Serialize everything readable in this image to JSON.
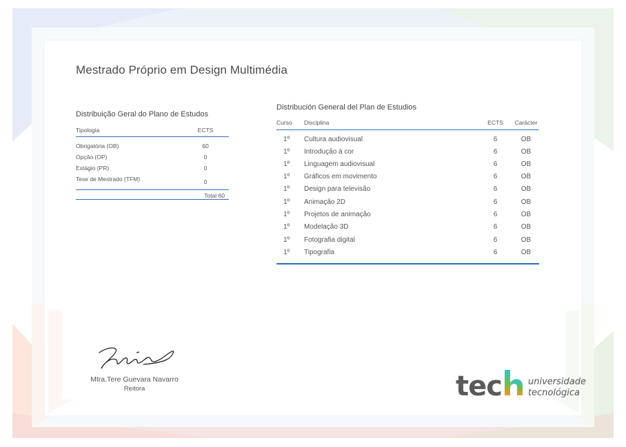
{
  "colors": {
    "accent": "#2c6fb5",
    "logo_text": "#5a5a5a",
    "logo_h_top": "#2ec4d6",
    "logo_h_bottom": "#f7931e"
  },
  "title": "Mestrado Próprio em Design Multimédia",
  "left_table": {
    "heading": "Distribuição Geral do Plano de Estudos",
    "col_type": "Tipologia",
    "col_ects": "ECTS",
    "rows": [
      {
        "type": "Obrigatória (OB)",
        "ects": "60"
      },
      {
        "type": "Opção (OP)",
        "ects": "0"
      },
      {
        "type": "Estágio (PR)",
        "ects": "0"
      },
      {
        "type": "Tese de Mestrado (TFM)",
        "ects": "0"
      }
    ],
    "total": "Total 60"
  },
  "right_table": {
    "heading": "Distribución General del Plan de Estudios",
    "col_course": "Curso",
    "col_subject": "Disciplina",
    "col_ects": "ECTS",
    "col_character": "Carácter",
    "rows": [
      {
        "course": "1º",
        "subject": "Cultura audiovisual",
        "ects": "6",
        "character": "OB"
      },
      {
        "course": "1º",
        "subject": "Introdução à cor",
        "ects": "6",
        "character": "OB"
      },
      {
        "course": "1º",
        "subject": "Linguagem audiovisual",
        "ects": "6",
        "character": "OB"
      },
      {
        "course": "1º",
        "subject": "Gráficos em movimento",
        "ects": "6",
        "character": "OB"
      },
      {
        "course": "1º",
        "subject": "Design para televisão",
        "ects": "6",
        "character": "OB"
      },
      {
        "course": "1º",
        "subject": "Animação 2D",
        "ects": "6",
        "character": "OB"
      },
      {
        "course": "1º",
        "subject": "Projetos de animação",
        "ects": "6",
        "character": "OB"
      },
      {
        "course": "1º",
        "subject": "Modelação 3D",
        "ects": "6",
        "character": "OB"
      },
      {
        "course": "1º",
        "subject": "Fotografia digital",
        "ects": "6",
        "character": "OB"
      },
      {
        "course": "1º",
        "subject": "Tipografia",
        "ects": "6",
        "character": "OB"
      }
    ]
  },
  "signature": {
    "name": "Mtra.Tere Guevara Navarro",
    "role": "Reitora"
  },
  "logo": {
    "word": "tech",
    "line1": "universidade",
    "line2": "tecnológica"
  }
}
